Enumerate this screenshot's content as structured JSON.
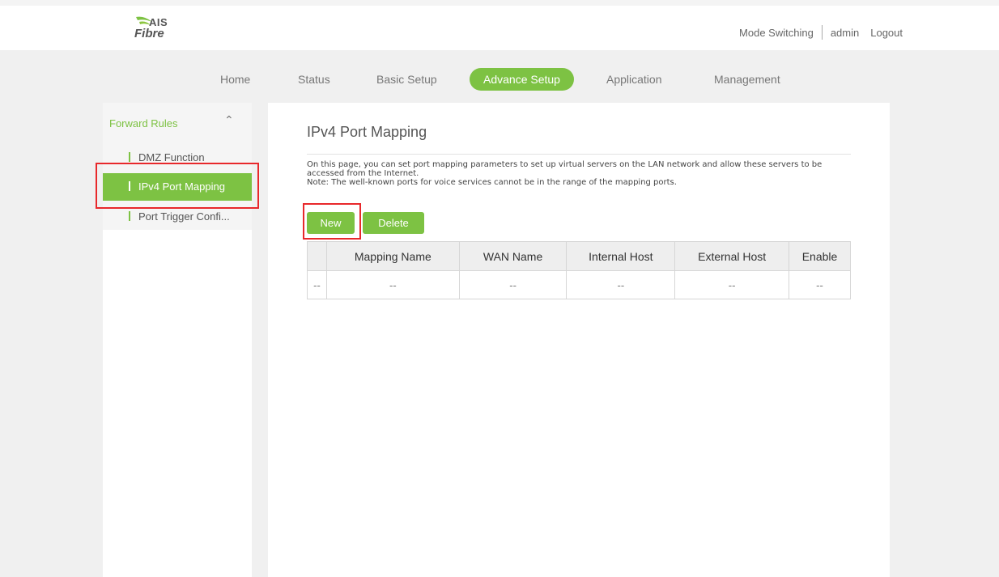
{
  "header": {
    "logo_top": "AIS",
    "logo_bottom": "Fibre",
    "mode_switching": "Mode Switching",
    "user": "admin",
    "logout": "Logout"
  },
  "nav": {
    "home": "Home",
    "status": "Status",
    "basic_setup": "Basic Setup",
    "advance_setup": "Advance Setup",
    "application": "Application",
    "management": "Management"
  },
  "sidebar": {
    "group": "Forward Rules",
    "items": [
      "DMZ Function",
      "IPv4 Port Mapping",
      "Port Trigger Confi..."
    ]
  },
  "main": {
    "title": "IPv4 Port Mapping",
    "desc_line1": "On this page, you can set port mapping parameters to set up virtual servers on the LAN network and allow these servers to be",
    "desc_line2": "accessed from the Internet.",
    "desc_line3": "Note: The well-known ports for voice services cannot be in the range of the mapping ports.",
    "new_button": "New",
    "delete_button": "Delete"
  },
  "table": {
    "headers": [
      "",
      "Mapping Name",
      "WAN Name",
      "Internal Host",
      "External Host",
      "Enable"
    ],
    "rows": [
      [
        "--",
        "--",
        "--",
        "--",
        "--",
        "--"
      ]
    ]
  },
  "colors": {
    "accent": "#7dc243",
    "highlight": "#e8282b"
  }
}
